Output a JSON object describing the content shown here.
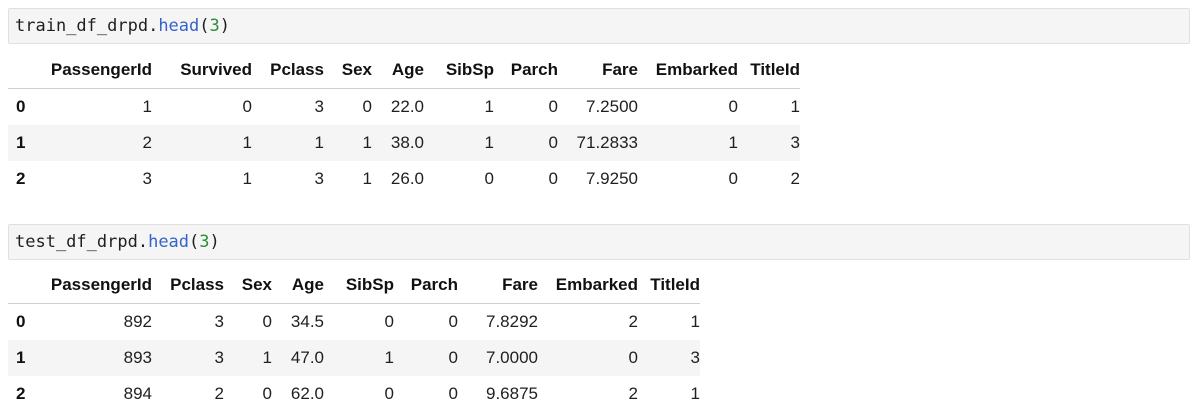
{
  "train": {
    "code": {
      "var": "train_df_drpd",
      "dot": ".",
      "method": "head",
      "open": "(",
      "arg": "3",
      "close": ")"
    },
    "columns": [
      "PassengerId",
      "Survived",
      "Pclass",
      "Sex",
      "Age",
      "SibSp",
      "Parch",
      "Fare",
      "Embarked",
      "TitleId"
    ],
    "rows": [
      {
        "index": "0",
        "cells": [
          "1",
          "0",
          "3",
          "0",
          "22.0",
          "1",
          "0",
          "7.2500",
          "0",
          "1"
        ]
      },
      {
        "index": "1",
        "cells": [
          "2",
          "1",
          "1",
          "1",
          "38.0",
          "1",
          "0",
          "71.2833",
          "1",
          "3"
        ]
      },
      {
        "index": "2",
        "cells": [
          "3",
          "1",
          "3",
          "1",
          "26.0",
          "0",
          "0",
          "7.9250",
          "0",
          "2"
        ]
      }
    ]
  },
  "test": {
    "code": {
      "var": "test_df_drpd",
      "dot": ".",
      "method": "head",
      "open": "(",
      "arg": "3",
      "close": ")"
    },
    "columns": [
      "PassengerId",
      "Pclass",
      "Sex",
      "Age",
      "SibSp",
      "Parch",
      "Fare",
      "Embarked",
      "TitleId"
    ],
    "rows": [
      {
        "index": "0",
        "cells": [
          "892",
          "3",
          "0",
          "34.5",
          "0",
          "0",
          "7.8292",
          "2",
          "1"
        ]
      },
      {
        "index": "1",
        "cells": [
          "893",
          "3",
          "1",
          "47.0",
          "1",
          "0",
          "7.0000",
          "0",
          "3"
        ]
      },
      {
        "index": "2",
        "cells": [
          "894",
          "2",
          "0",
          "62.0",
          "0",
          "0",
          "9.6875",
          "2",
          "1"
        ]
      }
    ]
  }
}
